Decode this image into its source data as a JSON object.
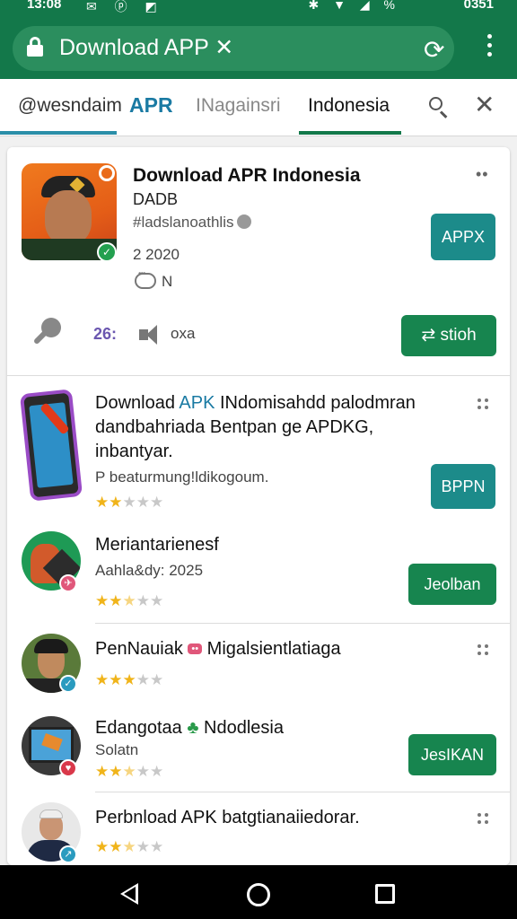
{
  "status_bar": {
    "time": "13:08",
    "battery": "0351",
    "left_icons": "✉ ⓟ ◩",
    "right_icons": "✱ ▼ ◢ %"
  },
  "app_bar": {
    "url": "Download APP ✕",
    "refresh_icon": "⟳"
  },
  "tabs": {
    "items": [
      "@wesndaim",
      "APR",
      "INagainsri",
      "Indonesia"
    ],
    "close_icon": "✕"
  },
  "hero": {
    "title": "Download APR Indonesia",
    "developer": "DADB",
    "tags": "#ladslanoathlis",
    "date": "2 2020",
    "comments": "N",
    "more": "••",
    "app_button": "APPX",
    "count": "26:",
    "size": "oxa",
    "install_button": "⇄ stioh"
  },
  "list": [
    {
      "title_prefix": "Download ",
      "title_accent": "APK",
      "title_rest": " INdomisahdd palodmran",
      "line2": "dandbahriada Bentpan ge APDKG,",
      "line3": "inbantyar.",
      "sub": "P beaturmung!ldikogoum.",
      "rating": 2,
      "button": "BPPN",
      "button_style": "teal"
    },
    {
      "title": "Meriantarienesf",
      "sub": "Aahla&dy: 2025",
      "rating": 2.5,
      "button": "Jeolban",
      "button_style": "green"
    },
    {
      "title": "PenNauiak",
      "title_badge": "••",
      "title_rest": " Migalsientlatiaga",
      "rating": 3
    },
    {
      "title": "Edangotaa",
      "title_badge": "♣",
      "title_rest": " Ndodlesia",
      "sub": "Solatn",
      "rating": 2.5,
      "button": "JesIKAN",
      "button_style": "green"
    },
    {
      "title": "Perbnload APK batgtianaiiedorar.",
      "rating": 2.5
    }
  ],
  "colors": {
    "primary_green": "#13784a",
    "teal_button": "#1c8b8a",
    "green_button": "#17854f",
    "star": "#f0b41a",
    "accent_blue": "#1a7aa3"
  }
}
